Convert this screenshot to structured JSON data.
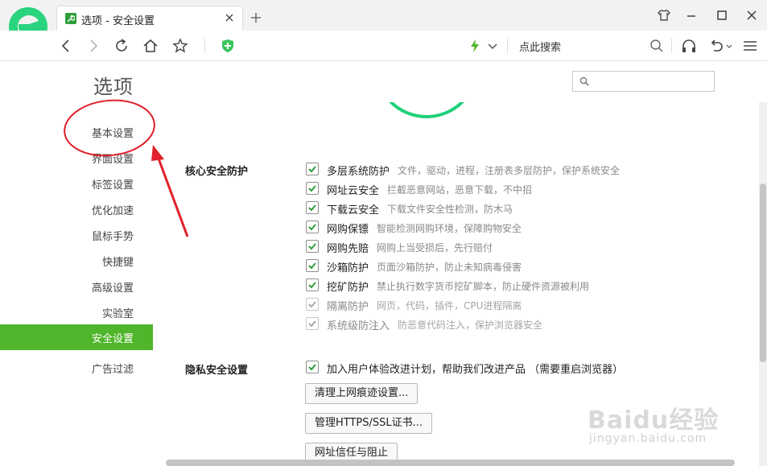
{
  "browser": {
    "tab_title": "选项 - 安全设置",
    "address_search_label": "点此搜索"
  },
  "page": {
    "title": "选项",
    "search_placeholder": ""
  },
  "sidebar": {
    "items": [
      {
        "label": "基本设置"
      },
      {
        "label": "界面设置"
      },
      {
        "label": "标签设置"
      },
      {
        "label": "优化加速"
      },
      {
        "label": "鼠标手势"
      },
      {
        "label": "快捷键"
      },
      {
        "label": "高级设置"
      },
      {
        "label": "实验室"
      },
      {
        "label": "安全设置",
        "active": true
      },
      {
        "label": "广告过滤"
      }
    ]
  },
  "core": {
    "label": "核心安全防护",
    "options": [
      {
        "name": "多层系统防护",
        "desc": "文件，驱动，进程，注册表多层防护，保护系统安全",
        "checked": true,
        "enabled": true
      },
      {
        "name": "网址云安全",
        "desc": "拦截恶意网站，恶意下载，不中招",
        "checked": true,
        "enabled": true
      },
      {
        "name": "下载云安全",
        "desc": "下载文件安全性检测，防木马",
        "checked": true,
        "enabled": true
      },
      {
        "name": "网购保镖",
        "desc": "智能检测网购环境，保障购物安全",
        "checked": true,
        "enabled": true
      },
      {
        "name": "网购先赔",
        "desc": "网购上当受损后，先行赔付",
        "checked": true,
        "enabled": true
      },
      {
        "name": "沙箱防护",
        "desc": "页面沙箱防护，防止未知病毒侵害",
        "checked": true,
        "enabled": true
      },
      {
        "name": "挖矿防护",
        "desc": "禁止执行数字货币挖矿脚本，防止硬件资源被利用",
        "checked": true,
        "enabled": true
      },
      {
        "name": "隔离防护",
        "desc": "网页，代码，插件，CPU进程隔离",
        "checked": true,
        "enabled": false
      },
      {
        "name": "系统级防注入",
        "desc": "防恶意代码注入，保护浏览器安全",
        "checked": true,
        "enabled": false
      }
    ]
  },
  "privacy": {
    "label": "隐私安全设置",
    "option": {
      "name": "加入用户体验改进计划，帮助我们改进产品 （需要重启浏览器）",
      "checked": true
    },
    "buttons": [
      {
        "label": "清理上网痕迹设置..."
      },
      {
        "label": "管理HTTPS/SSL证书..."
      },
      {
        "label": "网址信任与阻止"
      }
    ]
  },
  "watermark": {
    "brand": "Baidu经验",
    "url": "jingyan.baidu.com"
  },
  "colors": {
    "accent_green": "#4fb52a",
    "ring_green": "#1fd07a",
    "annotation_red": "#e0202a"
  }
}
